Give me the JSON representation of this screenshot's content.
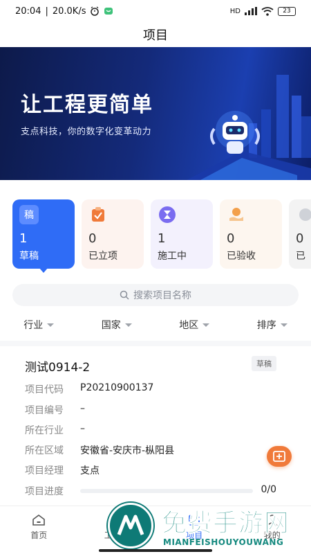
{
  "status_bar": {
    "time": "20:04",
    "speed": "20.0K/s",
    "net": "HD",
    "battery": "23"
  },
  "header": {
    "title": "项目"
  },
  "banner": {
    "title": "让工程更简单",
    "subtitle": "支点科技，你的数字化变革动力"
  },
  "status_cards": [
    {
      "icon": "稿",
      "count": "1",
      "label": "草稿",
      "active": true
    },
    {
      "icon": "clipboard-check-icon",
      "count": "0",
      "label": "已立项"
    },
    {
      "icon": "hourglass-icon",
      "count": "1",
      "label": "施工中"
    },
    {
      "icon": "hand-coin-icon",
      "count": "0",
      "label": "已验收"
    },
    {
      "icon": "",
      "count": "0",
      "label": "已"
    }
  ],
  "search": {
    "placeholder": "搜索项目名称"
  },
  "filters": [
    "行业",
    "国家",
    "地区",
    "排序"
  ],
  "project": {
    "name": "测试0914-2",
    "badge": "草稿",
    "rows": [
      {
        "key": "项目代码",
        "value": "P20210900137"
      },
      {
        "key": "项目编号",
        "value": "–"
      },
      {
        "key": "所在行业",
        "value": "–"
      },
      {
        "key": "所在区域",
        "value": "安徽省-安庆市-枞阳县"
      },
      {
        "key": "项目经理",
        "value": "支点"
      },
      {
        "key": "项目进度",
        "value": ""
      }
    ],
    "progress_text": "0/0",
    "progress": 0
  },
  "tabs": [
    {
      "label": "首页",
      "icon": "home-icon"
    },
    {
      "label": "工作台",
      "icon": "workbench-icon"
    },
    {
      "label": "项目",
      "icon": "project-icon",
      "active": true
    },
    {
      "label": "我的",
      "icon": "user-icon"
    }
  ],
  "watermark": {
    "title": "免费手游网",
    "subtitle": "MIANFEISHOUYOUWANG"
  },
  "colors": {
    "accent": "#2f6cf6",
    "fab": "#f07a3a",
    "watermark": "#15897f"
  }
}
